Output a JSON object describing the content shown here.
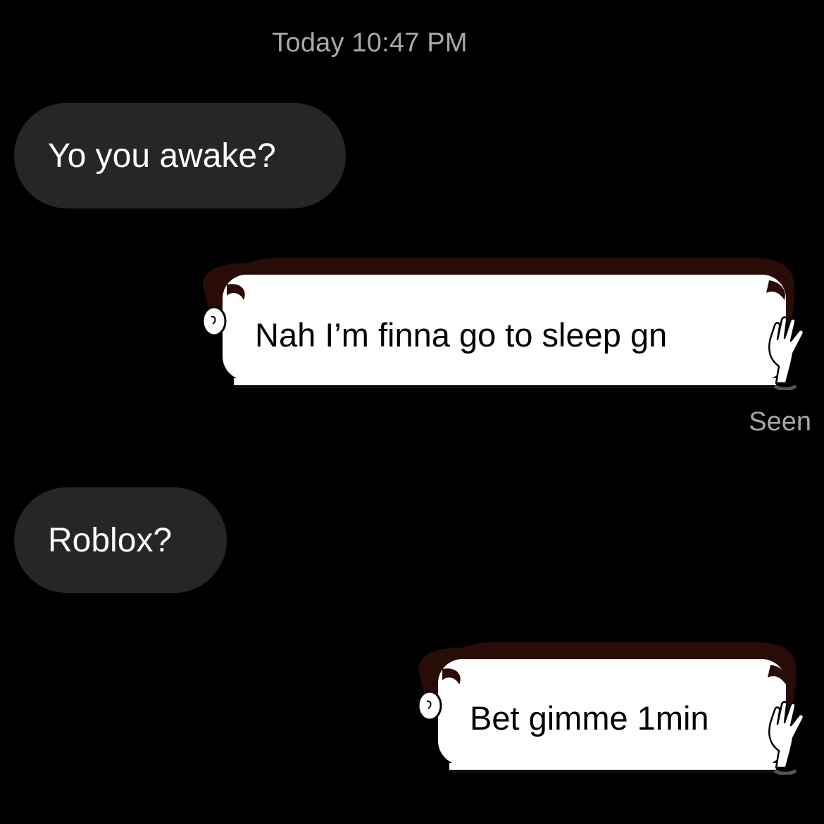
{
  "thread": {
    "timestamp": "Today 10:47 PM",
    "messages": [
      {
        "from": "them",
        "text": "Yo you awake?"
      },
      {
        "from": "me",
        "text": "Nah I’m finna go to sleep gn",
        "status": "Seen"
      },
      {
        "from": "them",
        "text": "Roblox?"
      },
      {
        "from": "me",
        "text": "Bet gimme 1min"
      }
    ]
  },
  "colors": {
    "background": "#000000",
    "incoming_bubble": "#262626",
    "sticker_hair": "#2a0c06",
    "sticker_face": "#ffffff",
    "meta_text": "#a8a8a8"
  },
  "icons": [
    "peeking-head-sticker",
    "waving-hand-icon"
  ]
}
